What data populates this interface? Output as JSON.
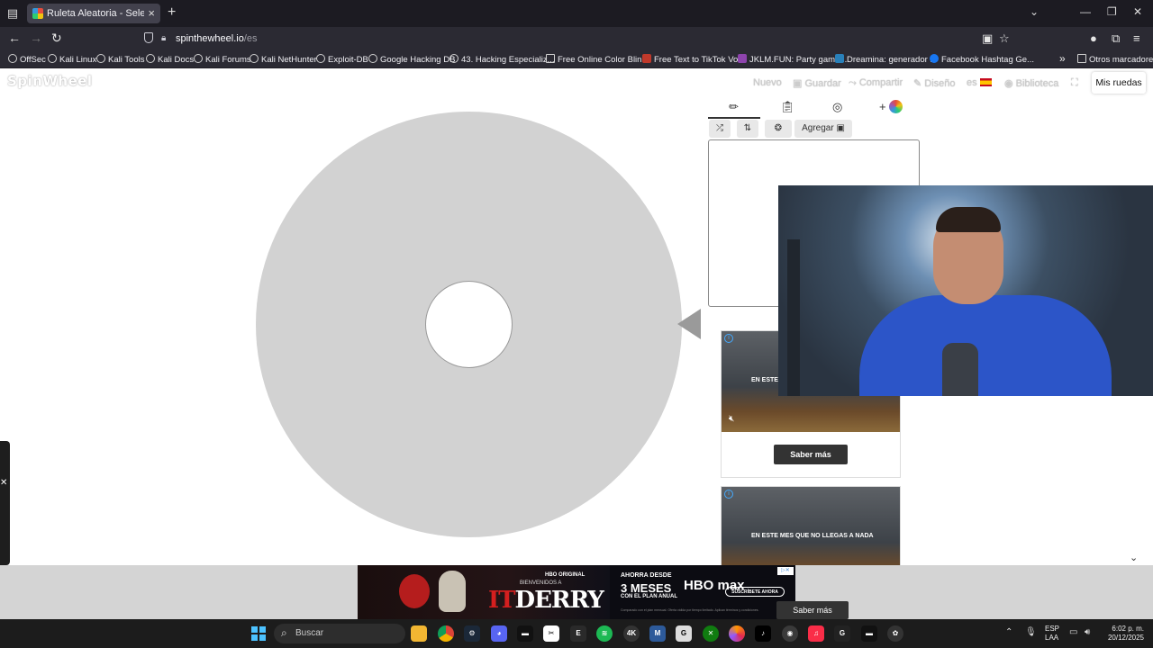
{
  "browser": {
    "tab_title": "Ruleta Aleatoria - Selector Perso",
    "url_domain": "spinthewheel.io",
    "url_path": "/es",
    "bookmarks": [
      "OffSec",
      "Kali Linux",
      "Kali Tools",
      "Kali Docs",
      "Kali Forums",
      "Kali NetHunter",
      "Exploit-DB",
      "Google Hacking DB",
      "43. Hacking Especializ...",
      "Free Online Color Blin...",
      "Free Text to TikTok Voi...",
      "JKLM.FUN: Party game...",
      "Dreamina: generador ...",
      "Facebook Hashtag Ge..."
    ],
    "other_bookmarks": "Otros marcadores"
  },
  "site": {
    "logo": "SpinWheel",
    "menu": {
      "nuevo": "Nuevo",
      "guardar": "Guardar",
      "compartir": "Compartir",
      "diseno": "Diseño",
      "idioma": "es",
      "biblioteca": "Biblioteca",
      "mis_ruedas": "Mis ruedas"
    },
    "toolbar": {
      "agregar": "Agregar"
    },
    "ads": {
      "caption_1": "EN ESTE",
      "caption_2": "EN ESTE MES QUE NO LLEGAS A NADA",
      "cta": "Saber más"
    }
  },
  "banner": {
    "hbo_original": "HBO ORIGINAL",
    "bienvenidos": "BIENVENIDOS A",
    "title_it": "IT",
    "title_derry": "DERRY",
    "offer_line1": "AHORRA DESDE",
    "offer_line2": "3 MESES",
    "offer_line3": "CON EL PLAN ANUAL",
    "brand": "HBO max",
    "cta": "SUSCRÍBETE AHORA",
    "fine_print": "Comparado con el plan mensual. Oferta válida por tiempo limitado. Aplican términos y condiciones."
  },
  "taskbar": {
    "search_placeholder": "Buscar",
    "lang_1": "ESP",
    "lang_2": "LAA",
    "time": "6:02 p. m.",
    "date": "20/12/2025"
  },
  "colors": {
    "wheel": "#d2d2d2",
    "pointer": "#9a9a9a",
    "browser_dark": "#2b2a33",
    "taskbar": "#1c1c1c",
    "accent_blue": "#4cc2ff"
  }
}
